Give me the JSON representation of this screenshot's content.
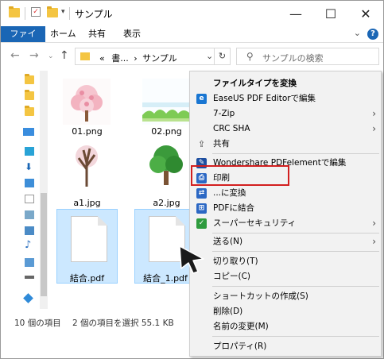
{
  "window": {
    "title": "サンプル"
  },
  "ribbon": {
    "tabs": [
      "ファイル",
      "ホーム",
      "共有",
      "表示"
    ]
  },
  "nav": {
    "address": [
      "«",
      "書...",
      "›",
      "サンプル"
    ],
    "search_placeholder": "サンプルの検索"
  },
  "files": [
    {
      "name": "01.png",
      "kind": "cherry-blossom-image",
      "selected": false
    },
    {
      "name": "02.png",
      "kind": "grass-image",
      "selected": false
    },
    {
      "name": "a1.jpg",
      "kind": "bare-tree-image",
      "selected": false
    },
    {
      "name": "a2.jpg",
      "kind": "green-tree-image",
      "selected": false
    },
    {
      "name": "結合.pdf",
      "kind": "pdf-file",
      "selected": true
    },
    {
      "name": "結合_1.pdf",
      "kind": "pdf-file",
      "selected": true
    }
  ],
  "status": {
    "count": "10 個の項目",
    "selection": "2 個の項目を選択 55.1 KB"
  },
  "context_menu": {
    "items": [
      {
        "label": "ファイルタイプを変換",
        "bold": true
      },
      {
        "label": "EaseUS PDF Editorで編集",
        "icon": "easeus-icon"
      },
      {
        "label": "7-Zip",
        "submenu": true
      },
      {
        "label": "CRC SHA",
        "submenu": true
      },
      {
        "label": "共有",
        "icon": "share-icon"
      },
      {
        "label": "Wondershare PDFelementで編集",
        "icon": "pdfelement-icon"
      },
      {
        "label": "印刷",
        "icon": "print-icon",
        "highlighted": true
      },
      {
        "label": "...に変換",
        "icon": "convert-icon"
      },
      {
        "label": "PDFに結合",
        "icon": "combine-icon"
      },
      {
        "label": "スーパーセキュリティ",
        "icon": "security-icon",
        "submenu": true
      },
      {
        "label": "送る(N)",
        "submenu": true
      },
      {
        "label": "切り取り(T)"
      },
      {
        "label": "コピー(C)"
      },
      {
        "label": "ショートカットの作成(S)"
      },
      {
        "label": "削除(D)"
      },
      {
        "label": "名前の変更(M)"
      },
      {
        "label": "プロパティ(R)"
      }
    ]
  },
  "colors": {
    "accent": "#1a66b5",
    "selection": "#cce8ff",
    "highlight_box": "#d21f1f"
  }
}
